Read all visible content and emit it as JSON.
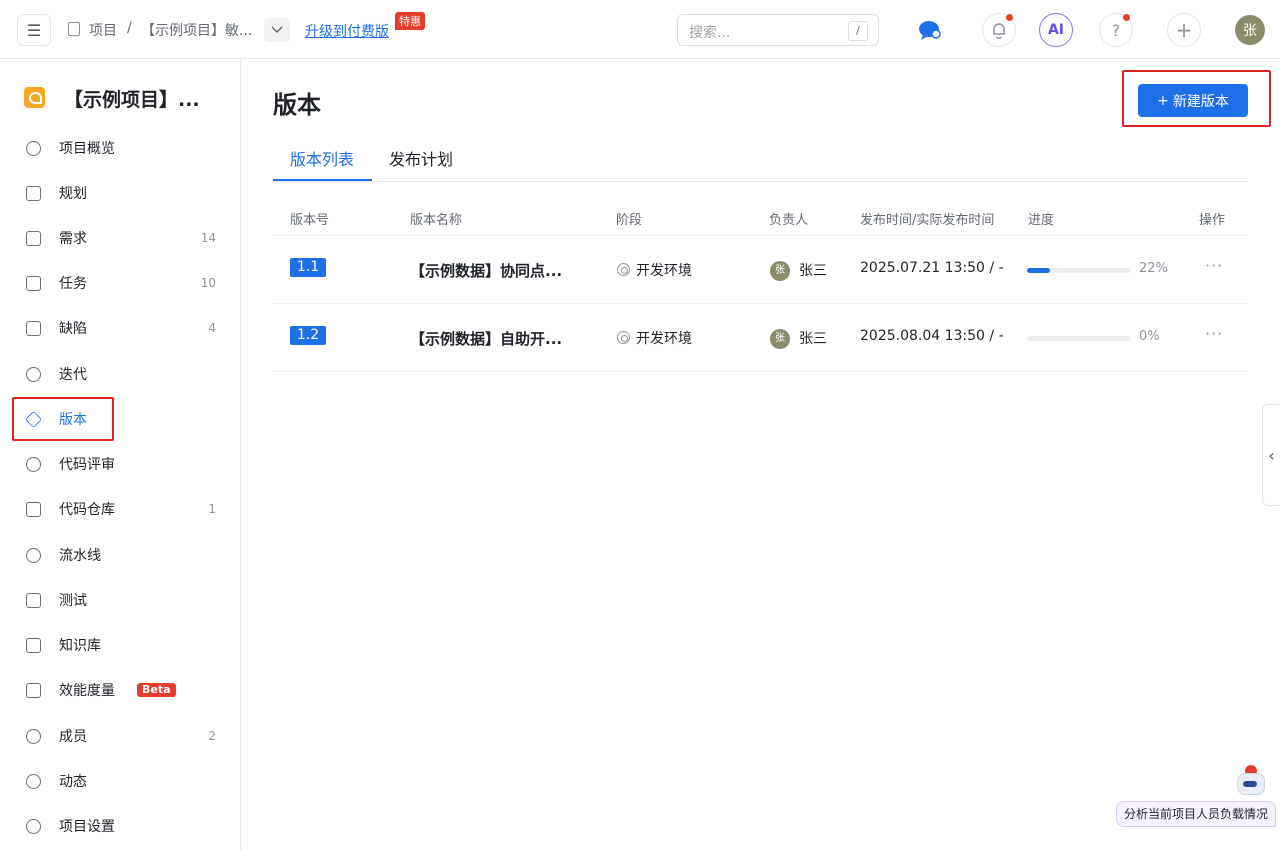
{
  "topbar": {
    "breadcrumb_root": "项目",
    "breadcrumb_sep": "/",
    "breadcrumb_project": "【示例项目】敏...",
    "upgrade_link": "升级到付费版",
    "promo_badge": "特惠",
    "search_placeholder": "搜索...",
    "search_shortcut": "/",
    "ai_label": "AI",
    "help_label": "?",
    "add_label": "+",
    "user_avatar": "张"
  },
  "sidebar": {
    "project_name": "【示例项目】...",
    "items": [
      {
        "label": "项目概览",
        "count": ""
      },
      {
        "label": "规划",
        "count": ""
      },
      {
        "label": "需求",
        "count": "14"
      },
      {
        "label": "任务",
        "count": "10"
      },
      {
        "label": "缺陷",
        "count": "4"
      },
      {
        "label": "迭代",
        "count": ""
      },
      {
        "label": "版本",
        "count": ""
      },
      {
        "label": "代码评审",
        "count": ""
      },
      {
        "label": "代码仓库",
        "count": "1"
      },
      {
        "label": "流水线",
        "count": ""
      },
      {
        "label": "测试",
        "count": ""
      },
      {
        "label": "知识库",
        "count": ""
      },
      {
        "label": "效能度量",
        "count": ""
      },
      {
        "label": "成员",
        "count": "2"
      },
      {
        "label": "动态",
        "count": ""
      },
      {
        "label": "项目设置",
        "count": ""
      }
    ],
    "beta_badge": "Beta"
  },
  "main": {
    "title": "版本",
    "new_button": "新建版本",
    "new_button_icon": "+",
    "tabs": [
      {
        "label": "版本列表"
      },
      {
        "label": "发布计划"
      }
    ],
    "columns": [
      "版本号",
      "版本名称",
      "阶段",
      "负责人",
      "发布时间/实际发布时间",
      "进度",
      "操作"
    ],
    "rows": [
      {
        "version": "1.1",
        "name": "【示例数据】协同点...",
        "stage": "开发环境",
        "owner_initial": "张",
        "owner": "张三",
        "time": "2025.07.21 13:50 / -",
        "progress_pct": "22%",
        "progress": 0.22,
        "more": "···"
      },
      {
        "version": "1.2",
        "name": "【示例数据】自助开...",
        "stage": "开发环境",
        "owner_initial": "张",
        "owner": "张三",
        "time": "2025.08.04 13:50 / -",
        "progress_pct": "0%",
        "progress": 0.0,
        "more": "···"
      }
    ]
  },
  "side_panel_toggle": "‹",
  "assistant": {
    "suggestion": "分析当前项目人员负载情况"
  },
  "colors": {
    "accent": "#1f6fe8",
    "highlight_box": "#e02424",
    "badge_red": "#e63c2d",
    "project_logo": "#f5a623"
  }
}
